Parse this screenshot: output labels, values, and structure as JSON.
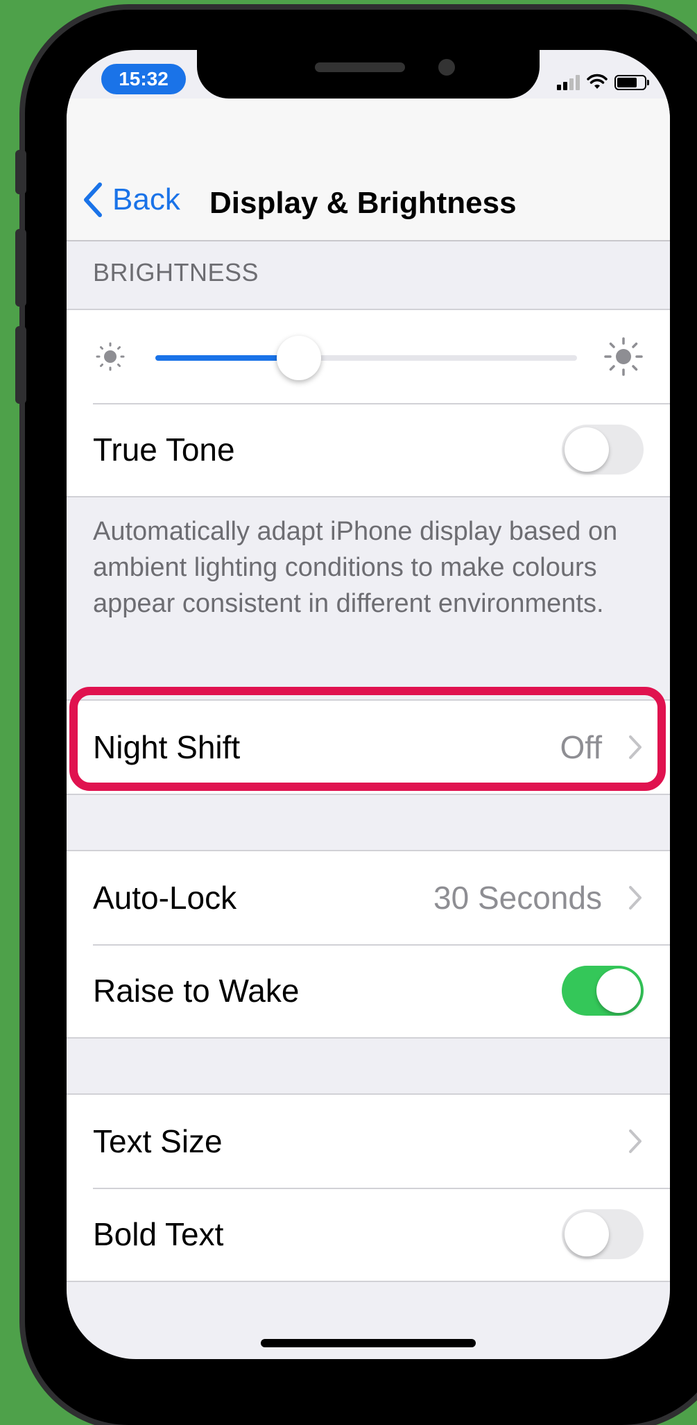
{
  "status_bar": {
    "time": "15:32"
  },
  "nav": {
    "back_label": "Back",
    "title": "Display & Brightness"
  },
  "brightness": {
    "header": "BRIGHTNESS",
    "level": 0.34
  },
  "true_tone": {
    "label": "True Tone",
    "enabled": false,
    "footnote": "Automatically adapt iPhone display based on ambient lighting conditions to make colours appear consistent in different environments."
  },
  "night_shift": {
    "label": "Night Shift",
    "value": "Off"
  },
  "auto_lock": {
    "label": "Auto-Lock",
    "value": "30 Seconds"
  },
  "raise_to_wake": {
    "label": "Raise to Wake",
    "enabled": true
  },
  "text_size": {
    "label": "Text Size"
  },
  "bold_text": {
    "label": "Bold Text",
    "enabled": false
  },
  "colors": {
    "accent": "#1a73e8",
    "toggle_on": "#34c759",
    "highlight": "#e0124f",
    "background": "#4ea14a"
  },
  "icons": {
    "back": "chevron-left-icon",
    "disclosure": "chevron-right-icon",
    "brightness_low": "sun-small-icon",
    "brightness_high": "sun-large-icon"
  }
}
